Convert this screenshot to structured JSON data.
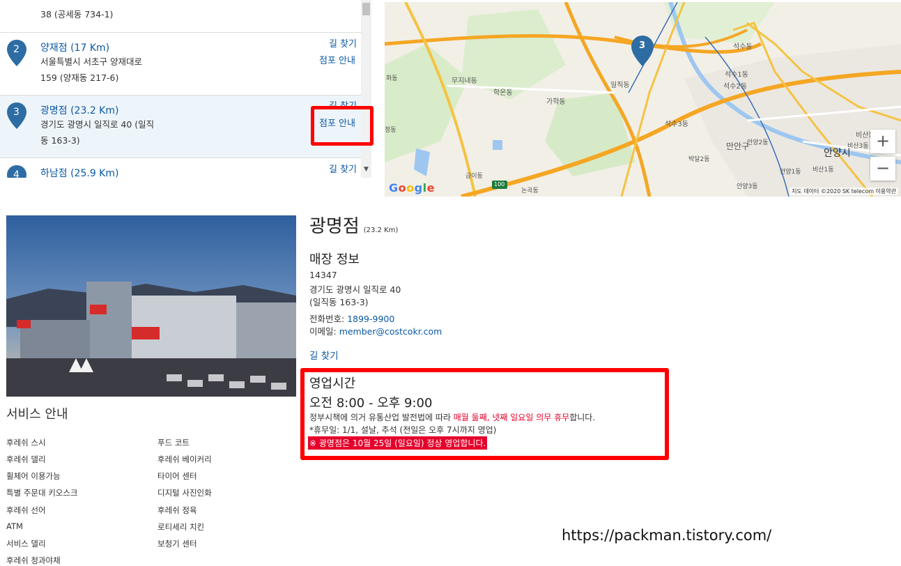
{
  "store_list": {
    "items": [
      {
        "number": "",
        "name": "",
        "addr_line1": "",
        "addr_line2": "38 (공세동 734-1)",
        "directions": "",
        "info": ""
      },
      {
        "number": "2",
        "name": "양재점 (17 Km)",
        "addr_line1": "서울특별시 서초구 양재대로",
        "addr_line2": "159 (양재동 217-6)",
        "directions": "길 찾기",
        "info": "점포 안내"
      },
      {
        "number": "3",
        "name": "광명점 (23.2 Km)",
        "addr_line1": "경기도 광명시 일직로 40 (일직",
        "addr_line2": "동 163-3)",
        "directions": "길 찾기",
        "info": "점포 안내"
      },
      {
        "number": "4",
        "name": "하남점 (25.9 Km)",
        "addr_line1": "",
        "addr_line2": "",
        "directions": "길 찾기",
        "info": ""
      }
    ],
    "active_index": 2
  },
  "map": {
    "marker_label": "3",
    "zoom_in": "+",
    "zoom_out": "−",
    "attribution": "지도 데이터 ©2020 SK telecom   이용약관",
    "logo": "Google",
    "place_labels": [
      "석수동",
      "석수1동",
      "석수2동",
      "석수3동",
      "일직동",
      "가학동",
      "학온동",
      "무지내동",
      "만안구",
      "안양시",
      "안양2동",
      "박달2동",
      "비산동",
      "비산3동",
      "비산1동",
      "안양1동",
      "안양3동",
      "금이동",
      "논곡동",
      "화동",
      "정동",
      "100"
    ]
  },
  "service": {
    "title": "서비스 안내",
    "left": [
      "후레쉬 스시",
      "후레쉬 델리",
      "휠체어 이용가능",
      "특별 주문대 키오스크",
      "후레쉬 선어",
      "ATM",
      "서비스 델리",
      "후레쉬 청과야채"
    ],
    "right": [
      "푸드 코트",
      "후레쉬 베이커리",
      "타이어 센터",
      "디지털 사진인화",
      "후레쉬 정육",
      "로티세리 치킨",
      "보청기 센터"
    ]
  },
  "detail": {
    "store_name": "광명점",
    "distance": "(23.2 Km)",
    "info_title": "매장 정보",
    "postal": "14347",
    "address1": "경기도 광명시 일직로 40",
    "address2": "(일직동 163-3)",
    "phone_label": "전화번호: ",
    "phone": "1899-9900",
    "email_label": "이메일: ",
    "email": "member@costcokr.com",
    "directions": "길 찾기"
  },
  "hours": {
    "title": "영업시간",
    "time": "오전 8:00 - 오후 9:00",
    "policy_prefix": "정부시책에 의거 유통산업 발전법에 따라 ",
    "policy_red": "매월 둘째, 넷째 일요일 의무 휴무",
    "policy_suffix": "합니다.",
    "holidays": "*휴무일: 1/1, 설날, 추석 (전일은 오후 7시까지 영업)",
    "notice": "※ 광명점은 10월 25일 (일요일) 정상 영업합니다."
  },
  "watermark": "https://packman.tistory.com/",
  "colors": {
    "link": "#0b58a2",
    "pin": "#2d6da3",
    "highlight": "#ff0000",
    "notice_bg": "#e4002b"
  }
}
